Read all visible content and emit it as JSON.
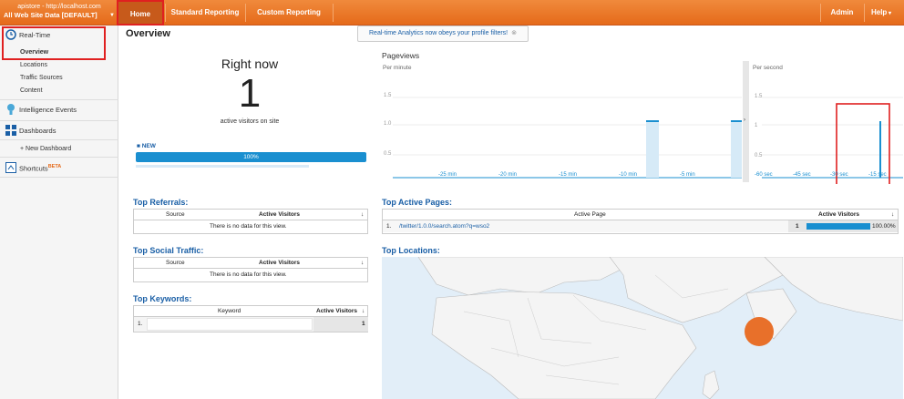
{
  "account": {
    "line1": "apistore - http://localhost.com",
    "line2": "All Web Site Data [DEFAULT]"
  },
  "nav": {
    "home": "Home",
    "standard": "Standard Reporting",
    "custom": "Custom Reporting",
    "admin": "Admin",
    "help": "Help"
  },
  "sidebar": {
    "realtime": "Real-Time",
    "overview": "Overview",
    "locations": "Locations",
    "traffic_sources": "Traffic Sources",
    "content": "Content",
    "intelligence": "Intelligence Events",
    "dashboards": "Dashboards",
    "new_dashboard": "+ New Dashboard",
    "shortcuts": "Shortcuts",
    "beta": "BETA"
  },
  "page": {
    "title": "Overview",
    "notice": "Real-time Analytics now obeys your profile filters!"
  },
  "right_now": {
    "title": "Right now",
    "count": "1",
    "subtitle": "active visitors on site",
    "new_label": "NEW",
    "new_pct": "100%"
  },
  "pageviews": {
    "title": "Pageviews",
    "per_minute": "Per minute",
    "per_second": "Per second",
    "minute_ticks": [
      "-25 min",
      "-20 min",
      "-15 min",
      "-10 min",
      "-5 min"
    ],
    "second_ticks": [
      "-60 sec",
      "-45 sec",
      "-30 sec",
      "-15 sec"
    ],
    "y_labels": [
      "1.5",
      "1.0",
      "0.5"
    ],
    "y_labels_sec": [
      "1.5",
      "1",
      "0.5"
    ]
  },
  "referrals": {
    "title": "Top Referrals:",
    "col1": "Source",
    "col2": "Active Visitors",
    "empty": "There is no data for this view."
  },
  "social": {
    "title": "Top Social Traffic:",
    "col1": "Source",
    "col2": "Active Visitors",
    "empty": "There is no data for this view."
  },
  "keywords": {
    "title": "Top Keywords:",
    "col1": "Keyword",
    "col2": "Active Visitors",
    "row_index": "1.",
    "row_value": "1"
  },
  "active_pages": {
    "title": "Top Active Pages:",
    "col1": "Active Page",
    "col2": "Active Visitors",
    "row_index": "1.",
    "row_page": "/twitter/1.0.0/search.atom?q=wso2",
    "row_count": "1",
    "row_pct": "100.00%",
    "fill_fraction": 1.0
  },
  "locations": {
    "title": "Top Locations:"
  },
  "colors": {
    "brand": "#e56a1a",
    "link": "#1a5fa6",
    "bar": "#1a8fd0",
    "marker": "#e8702a"
  }
}
